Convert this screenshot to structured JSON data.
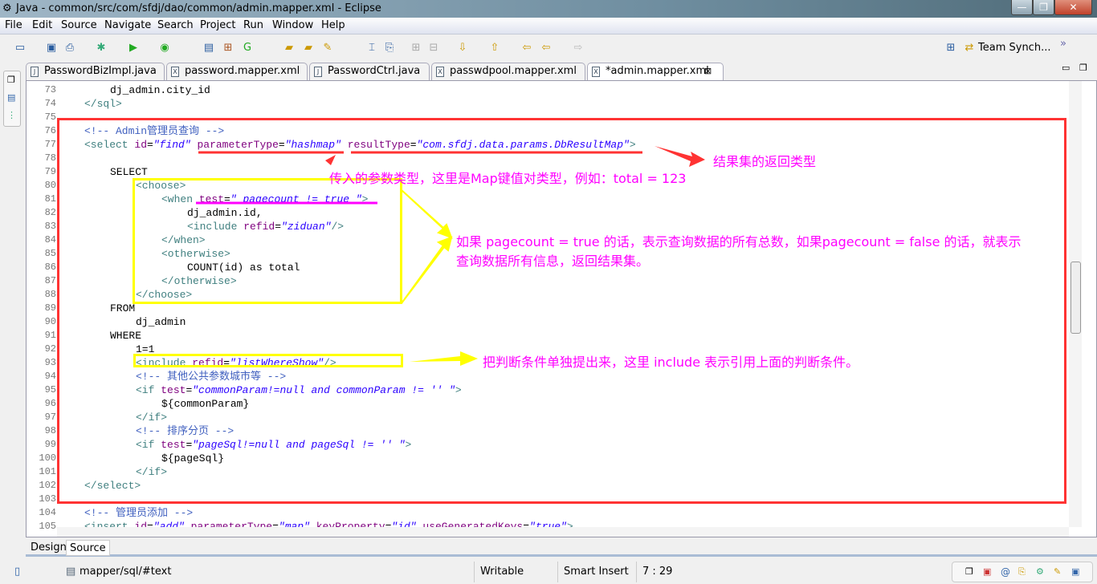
{
  "window": {
    "title": "Java - common/src/com/sfdj/dao/common/admin.mapper.xml - Eclipse",
    "minimize": "—",
    "restore": "❐",
    "close": "✕"
  },
  "menu": [
    "File",
    "Edit",
    "Source",
    "Navigate",
    "Search",
    "Project",
    "Run",
    "Window",
    "Help"
  ],
  "toolbar": {
    "perspective_label": "Team Synch...",
    "more": "»"
  },
  "tabs": [
    {
      "label": "PasswordBizImpl.java",
      "icon": "J"
    },
    {
      "label": "password.mapper.xml",
      "icon": "X"
    },
    {
      "label": "PasswordCtrl.java",
      "icon": "J"
    },
    {
      "label": "passwdpool.mapper.xml",
      "icon": "X"
    },
    {
      "label": "*admin.mapper.xml",
      "icon": "X",
      "active": true
    }
  ],
  "code": [
    {
      "n": "73",
      "i": 2,
      "s": [
        [
          "txt",
          "dj_admin.city_id"
        ]
      ]
    },
    {
      "n": "74",
      "i": 1,
      "s": [
        [
          "tag",
          "</sql>"
        ]
      ]
    },
    {
      "n": "75",
      "i": 0,
      "s": []
    },
    {
      "n": "76",
      "i": 1,
      "s": [
        [
          "com",
          "<!-- Admin管理员查询 -->"
        ]
      ]
    },
    {
      "n": "77",
      "i": 1,
      "s": [
        [
          "tag",
          "<select "
        ],
        [
          "att",
          "id"
        ],
        [
          "txt",
          "="
        ],
        [
          "val",
          "\"find\""
        ],
        [
          "txt",
          " "
        ],
        [
          "att",
          "parameterType"
        ],
        [
          "txt",
          "="
        ],
        [
          "val",
          "\"hashmap\""
        ],
        [
          "txt",
          " "
        ],
        [
          "att",
          "resultType"
        ],
        [
          "txt",
          "="
        ],
        [
          "val",
          "\"com.sfdj.data.params.DbResultMap\""
        ],
        [
          "tag",
          ">"
        ]
      ]
    },
    {
      "n": "78",
      "i": 0,
      "s": []
    },
    {
      "n": "79",
      "i": 2,
      "s": [
        [
          "txt",
          "SELECT"
        ]
      ]
    },
    {
      "n": "80",
      "i": 3,
      "s": [
        [
          "tag",
          "<choose>"
        ]
      ]
    },
    {
      "n": "81",
      "i": 4,
      "s": [
        [
          "tag",
          "<when "
        ],
        [
          "att",
          "test"
        ],
        [
          "txt",
          "="
        ],
        [
          "val",
          "\" pagecount != true \""
        ],
        [
          "tag",
          ">"
        ]
      ]
    },
    {
      "n": "82",
      "i": 5,
      "s": [
        [
          "txt",
          "dj_admin.id,"
        ]
      ]
    },
    {
      "n": "83",
      "i": 5,
      "s": [
        [
          "tag",
          "<include "
        ],
        [
          "att",
          "refid"
        ],
        [
          "txt",
          "="
        ],
        [
          "val",
          "\"ziduan\""
        ],
        [
          "tag",
          "/>"
        ]
      ]
    },
    {
      "n": "84",
      "i": 4,
      "s": [
        [
          "tag",
          "</when>"
        ]
      ]
    },
    {
      "n": "85",
      "i": 4,
      "s": [
        [
          "tag",
          "<otherwise>"
        ]
      ]
    },
    {
      "n": "86",
      "i": 5,
      "s": [
        [
          "txt",
          "COUNT(id) as total"
        ]
      ]
    },
    {
      "n": "87",
      "i": 4,
      "s": [
        [
          "tag",
          "</otherwise>"
        ]
      ]
    },
    {
      "n": "88",
      "i": 3,
      "s": [
        [
          "tag",
          "</choose>"
        ]
      ]
    },
    {
      "n": "89",
      "i": 2,
      "s": [
        [
          "txt",
          "FROM"
        ]
      ]
    },
    {
      "n": "90",
      "i": 3,
      "s": [
        [
          "txt",
          "dj_admin"
        ]
      ]
    },
    {
      "n": "91",
      "i": 2,
      "s": [
        [
          "txt",
          "WHERE"
        ]
      ]
    },
    {
      "n": "92",
      "i": 3,
      "s": [
        [
          "txt",
          "1=1"
        ]
      ]
    },
    {
      "n": "93",
      "i": 3,
      "s": [
        [
          "tag",
          "<include "
        ],
        [
          "att",
          "refid"
        ],
        [
          "txt",
          "="
        ],
        [
          "val",
          "\"listWhereShow\""
        ],
        [
          "tag",
          "/>"
        ]
      ]
    },
    {
      "n": "94",
      "i": 3,
      "s": [
        [
          "com",
          "<!-- 其他公共参数城市等 -->"
        ]
      ]
    },
    {
      "n": "95",
      "i": 3,
      "s": [
        [
          "tag",
          "<if "
        ],
        [
          "att",
          "test"
        ],
        [
          "txt",
          "="
        ],
        [
          "val",
          "\"commonParam!=null and commonParam != '' \""
        ],
        [
          "tag",
          ">"
        ]
      ]
    },
    {
      "n": "96",
      "i": 4,
      "s": [
        [
          "txt",
          "${commonParam}"
        ]
      ]
    },
    {
      "n": "97",
      "i": 3,
      "s": [
        [
          "tag",
          "</if>"
        ]
      ]
    },
    {
      "n": "98",
      "i": 3,
      "s": [
        [
          "com",
          "<!-- 排序分页 -->"
        ]
      ]
    },
    {
      "n": "99",
      "i": 3,
      "s": [
        [
          "tag",
          "<if "
        ],
        [
          "att",
          "test"
        ],
        [
          "txt",
          "="
        ],
        [
          "val",
          "\"pageSql!=null and pageSql != '' \""
        ],
        [
          "tag",
          ">"
        ]
      ]
    },
    {
      "n": "100",
      "i": 4,
      "s": [
        [
          "txt",
          "${pageSql}"
        ]
      ]
    },
    {
      "n": "101",
      "i": 3,
      "s": [
        [
          "tag",
          "</if>"
        ]
      ]
    },
    {
      "n": "102",
      "i": 1,
      "s": [
        [
          "tag",
          "</select>"
        ]
      ]
    },
    {
      "n": "103",
      "i": 0,
      "s": []
    },
    {
      "n": "104",
      "i": 1,
      "s": [
        [
          "com",
          "<!-- 管理员添加 -->"
        ]
      ]
    },
    {
      "n": "105",
      "i": 1,
      "s": [
        [
          "tag",
          "<insert "
        ],
        [
          "att",
          "id"
        ],
        [
          "txt",
          "="
        ],
        [
          "val",
          "\"add\""
        ],
        [
          "txt",
          " "
        ],
        [
          "att",
          "parameterType"
        ],
        [
          "txt",
          "="
        ],
        [
          "val",
          "\"map\""
        ],
        [
          "txt",
          " "
        ],
        [
          "att",
          "keyProperty"
        ],
        [
          "txt",
          "="
        ],
        [
          "val",
          "\"id\""
        ],
        [
          "txt",
          " "
        ],
        [
          "att",
          "useGeneratedKeys"
        ],
        [
          "txt",
          "="
        ],
        [
          "val",
          "\"true\""
        ],
        [
          "tag",
          ">"
        ]
      ]
    }
  ],
  "annotations": {
    "param_type": "传入的参数类型，这里是Map键值对类型，例如：total = 123",
    "result_type": "结果集的返回类型",
    "choose_line1": "如果 pagecount = true 的话，表示查询数据的所有总数，如果pagecount = false 的话，就表示",
    "choose_line2": "查询数据所有信息，返回结果集。",
    "include": "把判断条件单独提出来，这里 include 表示引用上面的判断条件。"
  },
  "colors": {
    "red_box": "#ff3333",
    "yellow_box": "#ffff00",
    "annotation_text": "#ff00ff"
  },
  "bottom_tabs": [
    "Design",
    "Source"
  ],
  "status": {
    "path": "mapper/sql/#text",
    "mode": "Writable",
    "insert": "Smart Insert",
    "position": "7 : 29"
  }
}
